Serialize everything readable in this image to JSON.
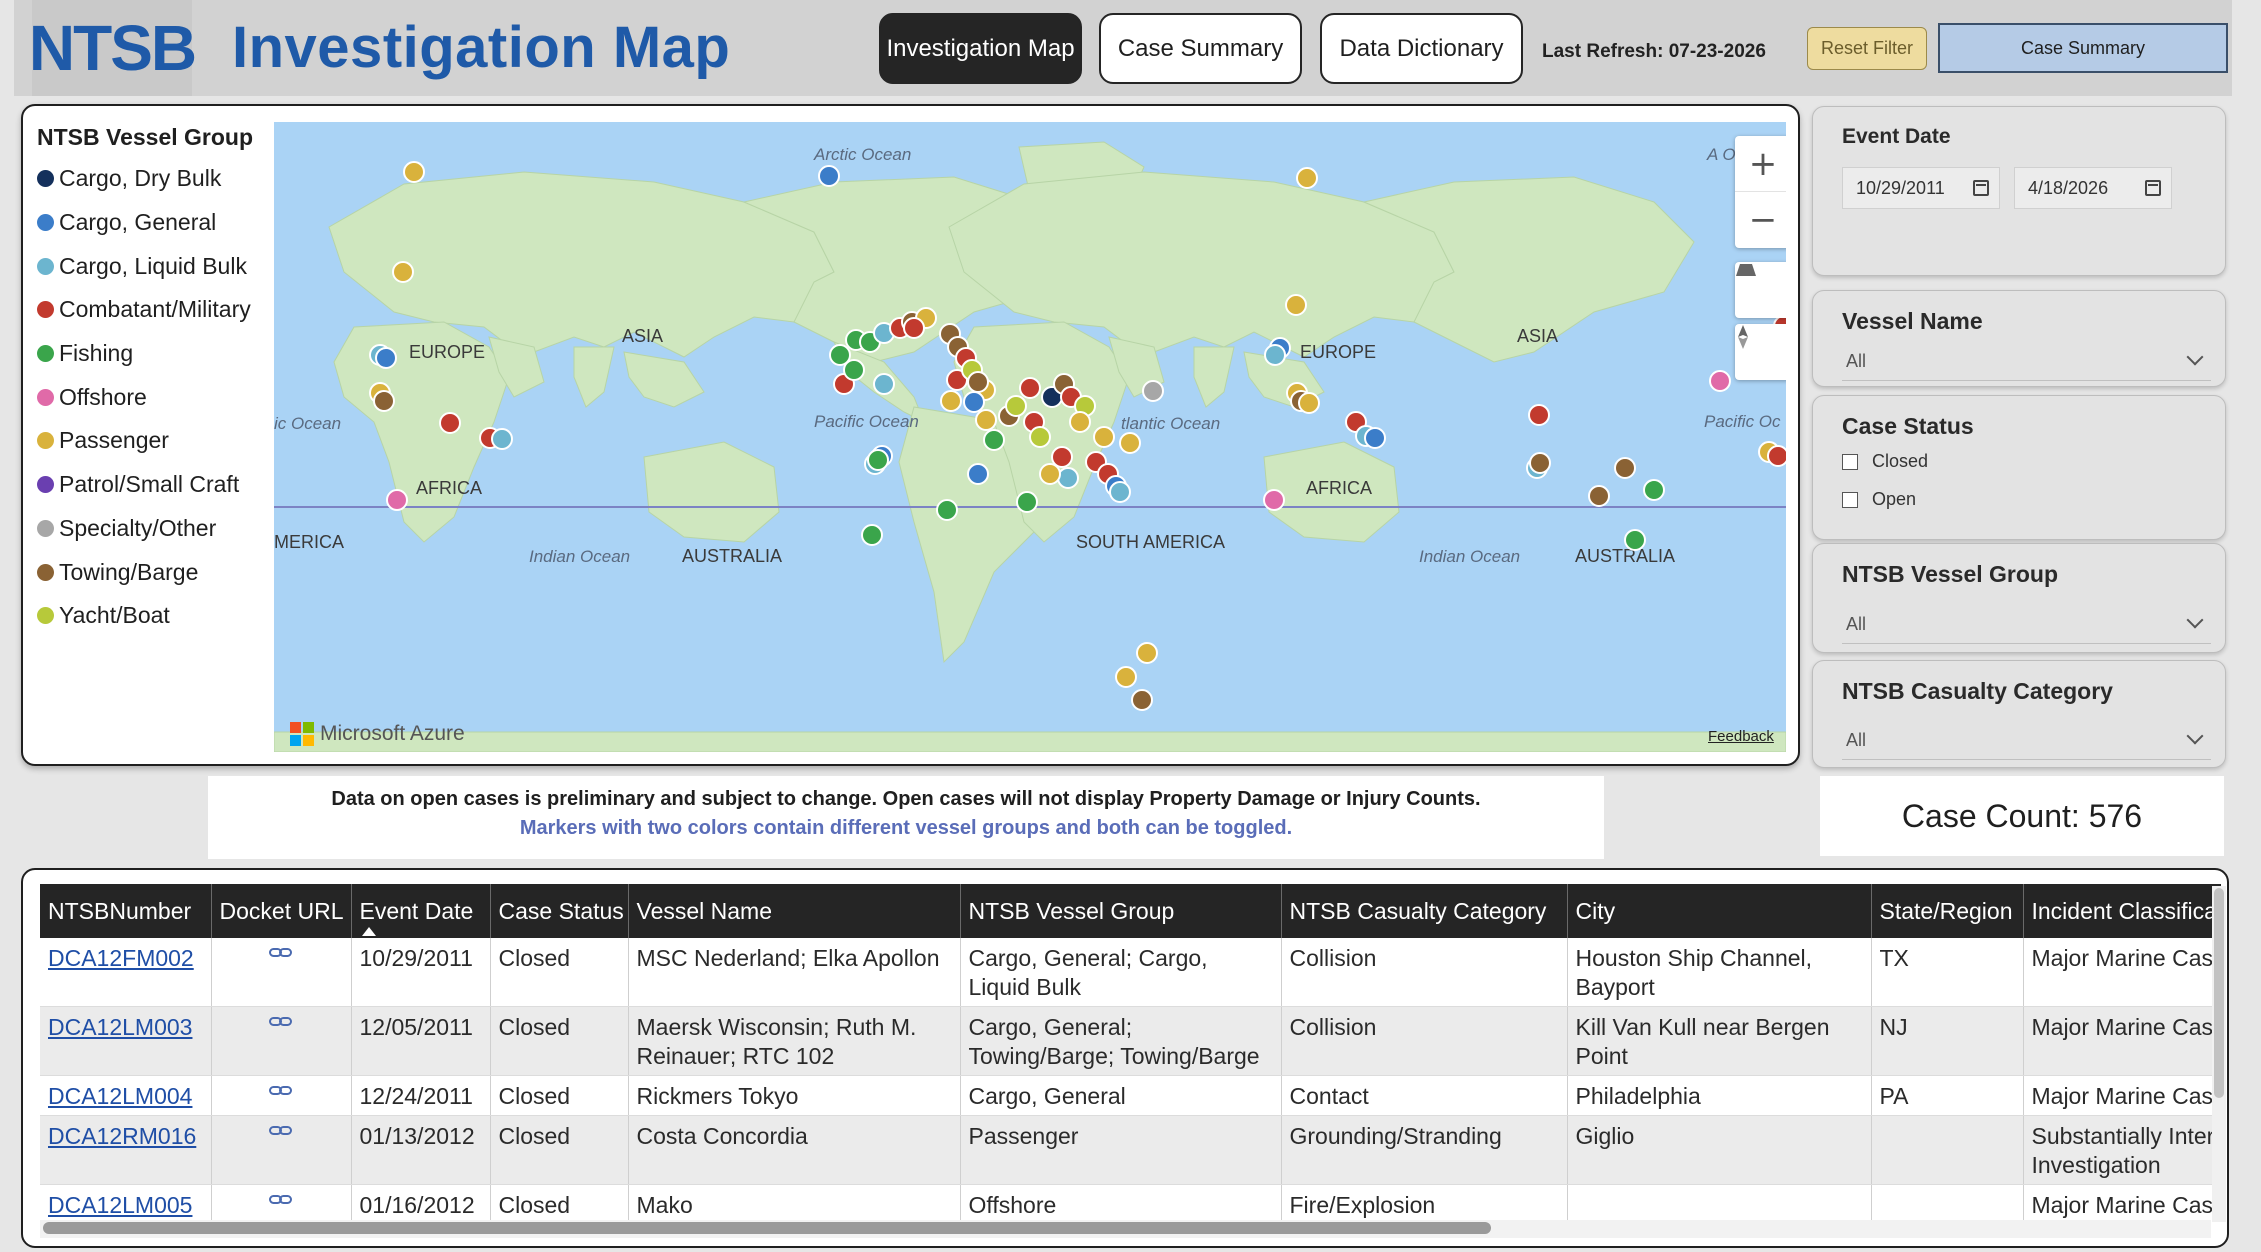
{
  "header": {
    "logo": "NTSB",
    "title": "Investigation Map",
    "nav": [
      "Investigation Map",
      "Case Summary",
      "Data Dictionary"
    ],
    "last_refresh": "Last Refresh: 07-23-2026",
    "reset_filter": "Reset Filter",
    "case_summary_button": "Case Summary"
  },
  "legend": {
    "title": "NTSB Vessel Group",
    "items": [
      {
        "label": "Cargo, Dry Bulk",
        "color": "#14305c"
      },
      {
        "label": "Cargo, General",
        "color": "#3b7dc9"
      },
      {
        "label": "Cargo, Liquid Bulk",
        "color": "#6cb5cf"
      },
      {
        "label": "Combatant/Military",
        "color": "#c23a2e"
      },
      {
        "label": "Fishing",
        "color": "#3aa54b"
      },
      {
        "label": "Offshore",
        "color": "#e06aa8"
      },
      {
        "label": "Passenger",
        "color": "#d9b23c"
      },
      {
        "label": "Patrol/Small Craft",
        "color": "#6a3fb0"
      },
      {
        "label": "Specialty/Other",
        "color": "#a7a7a7"
      },
      {
        "label": "Towing/Barge",
        "color": "#8a6234"
      },
      {
        "label": "Yacht/Boat",
        "color": "#b7c93a"
      }
    ]
  },
  "map": {
    "labels": {
      "arctic_ocean": "Arctic Ocean",
      "pacific_ocean": "Pacific Ocean",
      "pacific_ocean_2": "Pacific Oc",
      "atlantic_ocean": "tlantic Ocean",
      "atlantic_ocean_left": "ic Ocean",
      "indian_ocean": "Indian Ocean",
      "indian_ocean_2": "Indian Ocean",
      "europe": "EUROPE",
      "europe_2": "EUROPE",
      "asia": "ASIA",
      "asia_2": "ASIA",
      "africa": "AFRICA",
      "africa_2": "AFRICA",
      "australia": "AUSTRALIA",
      "australia_2": "AUSTRALIA",
      "south_america": "SOUTH AMERICA",
      "america_left": "MERICA",
      "arctic_right": "A   Oc"
    },
    "attribution": "Microsoft Azure",
    "feedback": "Feedback",
    "zoom_in": "+",
    "zoom_out": "−"
  },
  "filters": {
    "event_date": {
      "title": "Event Date",
      "start": "10/29/2011",
      "end": "4/18/2026"
    },
    "vessel_name": {
      "title": "Vessel Name",
      "value": "All"
    },
    "case_status": {
      "title": "Case Status",
      "options": [
        "Closed",
        "Open"
      ]
    },
    "vessel_group": {
      "title": "NTSB Vessel Group",
      "value": "All"
    },
    "casualty_category": {
      "title": "NTSB Casualty Category",
      "value": "All"
    }
  },
  "case_count": "Case Count: 576",
  "disclaimer": {
    "line1": "Data on open cases is preliminary and subject to change. Open cases will not display Property Damage or Injury Counts.",
    "line2": "Markers with two colors contain different vessel groups and both can be toggled."
  },
  "table": {
    "columns": [
      "NTSBNumber",
      "Docket URL",
      "Event Date",
      "Case Status",
      "Vessel Name",
      "NTSB Vessel Group",
      "NTSB Casualty Category",
      "City",
      "State/Region",
      "Incident Classification"
    ],
    "rows": [
      [
        "DCA12FM002",
        "",
        "10/29/2011",
        "Closed",
        "MSC Nederland; Elka Apollon",
        "Cargo, General; Cargo, Liquid Bulk",
        "Collision",
        "Houston Ship Channel, Bayport",
        "TX",
        "Major Marine Casualty"
      ],
      [
        "DCA12LM003",
        "",
        "12/05/2011",
        "Closed",
        "Maersk Wisconsin; Ruth M. Reinauer; RTC 102",
        "Cargo, General; Towing/Barge; Towing/Barge",
        "Collision",
        "Kill Van Kull near Bergen Point",
        "NJ",
        "Major Marine Casualty"
      ],
      [
        "DCA12LM004",
        "",
        "12/24/2011",
        "Closed",
        "Rickmers Tokyo",
        "Cargo, General",
        "Contact",
        "Philadelphia",
        "PA",
        "Major Marine Casualty"
      ],
      [
        "DCA12RM016",
        "",
        "01/13/2012",
        "Closed",
        "Costa Concordia",
        "Passenger",
        "Grounding/Stranding",
        "Giglio",
        "",
        "Substantially Interested Investigation"
      ],
      [
        "DCA12LM005",
        "",
        "01/16/2012",
        "Closed",
        "Mako",
        "Offshore",
        "Fire/Explosion",
        "",
        "",
        "Major Marine Casualty"
      ]
    ]
  }
}
